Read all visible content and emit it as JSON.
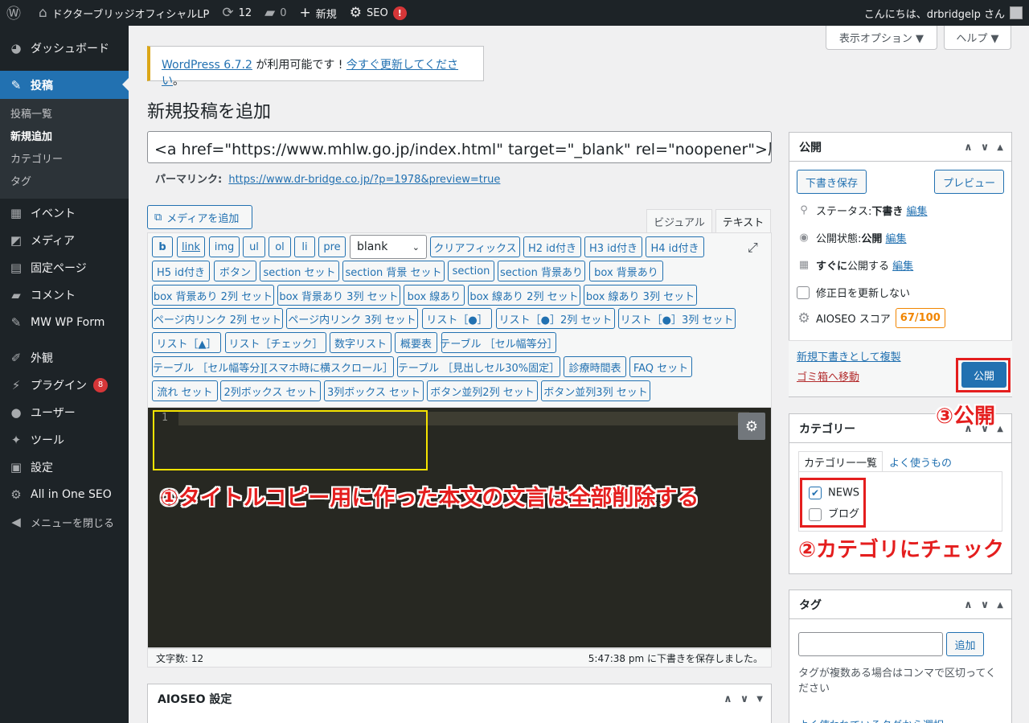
{
  "adminbar": {
    "wp_logo": "wordpress-icon",
    "site_name": "ドクターブリッジオフィシャルLP",
    "updates_count": "12",
    "comments_count": "0",
    "new_label": "新規",
    "seo_label": "SEO",
    "seo_badge": "!",
    "greeting": "こんにちは、drbridgelp さん"
  },
  "sidebar": {
    "items": [
      {
        "label": "ダッシュボード",
        "icon": "dashboard-icon"
      },
      {
        "label": "投稿",
        "icon": "pin-icon"
      },
      {
        "label": "イベント",
        "icon": "calendar-icon"
      },
      {
        "label": "メディア",
        "icon": "media-icon"
      },
      {
        "label": "固定ページ",
        "icon": "page-icon"
      },
      {
        "label": "コメント",
        "icon": "comment-icon"
      },
      {
        "label": "MW WP Form",
        "icon": "pin-icon"
      },
      {
        "label": "外観",
        "icon": "brush-icon"
      },
      {
        "label": "プラグイン",
        "icon": "plugin-icon",
        "badge": "8"
      },
      {
        "label": "ユーザー",
        "icon": "user-icon"
      },
      {
        "label": "ツール",
        "icon": "wrench-icon"
      },
      {
        "label": "設定",
        "icon": "settings-icon"
      },
      {
        "label": "All in One SEO",
        "icon": "aioseo-icon"
      },
      {
        "label": "メニューを閉じる",
        "icon": "collapse-icon"
      }
    ],
    "submenu": [
      "投稿一覧",
      "新規追加",
      "カテゴリー",
      "タグ"
    ]
  },
  "screen_options": {
    "label": "表示オプション ▼",
    "help": "ヘルプ ▼"
  },
  "notice": {
    "link": "WordPress 6.7.2",
    "text": " が利用可能です ! ",
    "link2": "今すぐ更新してください",
    "end": "。"
  },
  "page": {
    "title": "新規投稿を追加",
    "post_title_value": "<a href=\"https://www.mhlw.go.jp/index.html\" target=\"_blank\" rel=\"noopener\">厚",
    "permalink_label": "パーマリンク:",
    "permalink_url": "https://www.dr-bridge.co.jp/?p=1978&preview=true"
  },
  "editor": {
    "media_button": "メディアを追加",
    "tab_visual": "ビジュアル",
    "tab_text": "テキスト",
    "select_value": "blank",
    "buttons": [
      "b",
      "link",
      "img",
      "ul",
      "ol",
      "li",
      "pre",
      "クリアフィックス",
      "H2 id付き",
      "H3 id付き",
      "H4 id付き",
      "H5 id付き",
      "ボタン",
      "section セット",
      "section 背景 セット",
      "section",
      "section 背景あり",
      "box 背景あり",
      "box 背景あり 2列 セット",
      "box 背景あり 3列 セット",
      "box 線あり",
      "box 線あり 2列 セット",
      "box 線あり 3列 セット",
      "ページ内リンク 2列 セット",
      "ページ内リンク 3列 セット",
      "リスト［●］",
      "リスト［●］2列 セット",
      "リスト［●］3列 セット",
      "リスト［▲］",
      "リスト［チェック］",
      "数字リスト",
      "概要表",
      "テーブル ［セル幅等分］",
      "テーブル ［セル幅等分][スマホ時に横スクロール］",
      "テーブル ［見出しセル30%固定］",
      "診療時間表",
      "FAQ セット",
      "流れ セット",
      "2列ボックス セット",
      "3列ボックス セット",
      "ボタン並列2列 セット",
      "ボタン並列3列 セット"
    ],
    "line_number": "1",
    "word_count": "文字数: 12",
    "autosave": "5:47:38 pm に下書きを保存しました。"
  },
  "annotations": {
    "step1": "①タイトルコピー用に作った本文の文言は全部削除する",
    "step2": "②カテゴリにチェック",
    "step3": "③公開"
  },
  "publish_box": {
    "title": "公開",
    "save_draft": "下書き保存",
    "preview": "プレビュー",
    "status_label": "ステータス: ",
    "status_value": "下書き",
    "visibility_label": "公開状態: ",
    "visibility_value": "公開",
    "schedule_bold": "すぐに",
    "schedule_label": "公開する",
    "edit": "編集",
    "update_date": "修正日を更新しない",
    "aioseo_label": "AIOSEO スコア",
    "aioseo_score": "67/100",
    "duplicate": "新規下書きとして複製",
    "trash": "ゴミ箱へ移動",
    "publish": "公開"
  },
  "category_box": {
    "title": "カテゴリー",
    "tab_all": "カテゴリー一覧",
    "tab_popular": "よく使うもの",
    "items": [
      {
        "label": "NEWS",
        "checked": true
      },
      {
        "label": "ブログ",
        "checked": false
      }
    ]
  },
  "tag_box": {
    "title": "タグ",
    "add": "追加",
    "help": "タグが複数ある場合はコンマで区切ってください",
    "popular_link": "よく使われているタグから選択"
  },
  "aioseo_box": {
    "title": "AIOSEO 設定"
  },
  "colors": {
    "accent": "#2271b1",
    "annotation_red": "#e41e1e",
    "annotation_yellow": "#f5e300",
    "score": "#f18500"
  }
}
